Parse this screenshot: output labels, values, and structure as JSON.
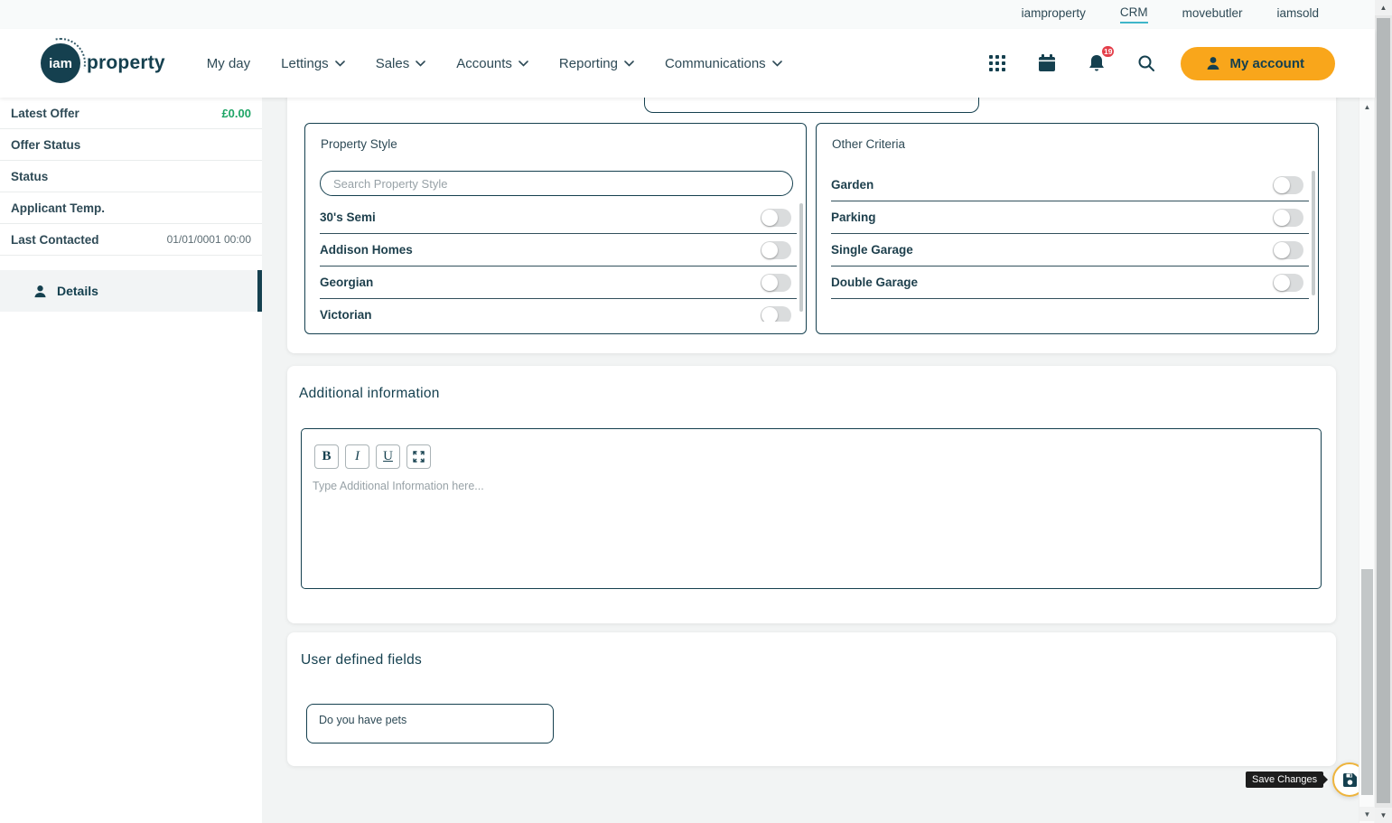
{
  "colors": {
    "brand_navy": "#15404F",
    "accent_orange": "#F9A61B",
    "active_link_teal": "#3FB6C9",
    "offer_green": "#1EA566",
    "badge_red": "#E43F4A"
  },
  "topbar": {
    "links": [
      {
        "label": "iamproperty",
        "active": false
      },
      {
        "label": "CRM",
        "active": true
      },
      {
        "label": "movebutler",
        "active": false
      },
      {
        "label": "iamsold",
        "active": false
      }
    ]
  },
  "header": {
    "logo": {
      "circle_text": "iam",
      "word": "property"
    },
    "nav": [
      {
        "label": "My day"
      },
      {
        "label": "Lettings"
      },
      {
        "label": "Sales"
      },
      {
        "label": "Accounts"
      },
      {
        "label": "Reporting"
      },
      {
        "label": "Communications"
      }
    ],
    "icons": [
      "apps-grid",
      "calendar",
      "notifications-bell",
      "search"
    ],
    "notifications_badge": "19",
    "account_button": "My account"
  },
  "sidebar": {
    "rows": [
      {
        "label": "Latest Offer",
        "value": "£0.00"
      },
      {
        "label": "Offer Status",
        "value": ""
      },
      {
        "label": "Status",
        "value": ""
      },
      {
        "label": "Applicant Temp.",
        "value": ""
      },
      {
        "label": "Last Contacted",
        "value": "01/01/0001 00:00"
      }
    ],
    "active_item": {
      "label": "Details"
    }
  },
  "panels": {
    "property_style": {
      "title": "Property Style",
      "search_placeholder": "Search Property Style",
      "items": [
        {
          "label": "30's Semi",
          "enabled": false
        },
        {
          "label": "Addison Homes",
          "enabled": false
        },
        {
          "label": "Georgian",
          "enabled": false
        },
        {
          "label": "Victorian",
          "enabled": false
        }
      ]
    },
    "other_criteria": {
      "title": "Other Criteria",
      "items": [
        {
          "label": "Garden",
          "enabled": false
        },
        {
          "label": "Parking",
          "enabled": false
        },
        {
          "label": "Single Garage",
          "enabled": false
        },
        {
          "label": "Double Garage",
          "enabled": false
        }
      ]
    }
  },
  "additional_information": {
    "heading": "Additional information",
    "toolbar": {
      "bold": "B",
      "italic": "I",
      "underline": "U"
    },
    "placeholder": "Type Additional Information here..."
  },
  "user_defined_fields": {
    "heading": "User defined fields",
    "fields": [
      {
        "label": "Do you have pets"
      }
    ]
  },
  "save": {
    "tooltip": "Save Changes"
  }
}
